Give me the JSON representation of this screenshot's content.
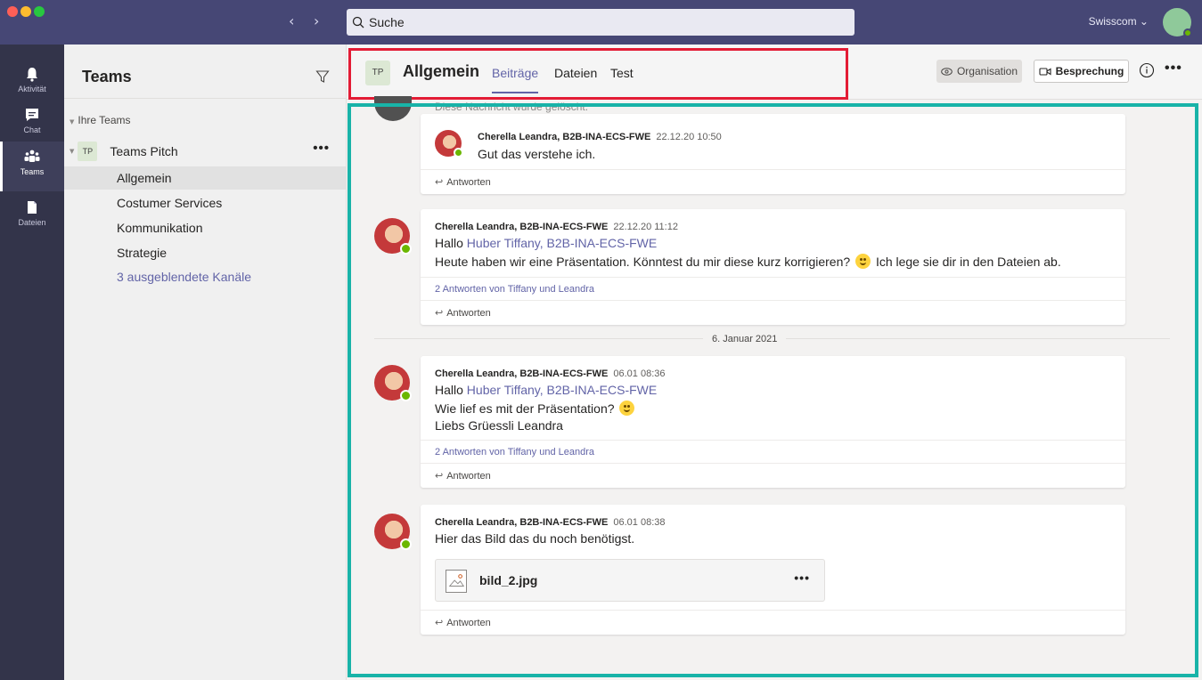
{
  "window": {
    "nav_back": "‹",
    "nav_forward": "›"
  },
  "search": {
    "placeholder": "Suche"
  },
  "account": {
    "org": "Swisscom ⌄"
  },
  "rail": {
    "items": [
      {
        "label": "Aktivität",
        "icon": "bell-icon"
      },
      {
        "label": "Chat",
        "icon": "chat-icon"
      },
      {
        "label": "Teams",
        "icon": "teams-icon"
      },
      {
        "label": "Dateien",
        "icon": "file-icon"
      }
    ]
  },
  "sidebar": {
    "title": "Teams",
    "section": "Ihre Teams",
    "team": {
      "badge": "TP",
      "name": "Teams Pitch",
      "more": "•••"
    },
    "channels": [
      "Allgemein",
      "Costumer Services",
      "Kommunikation",
      "Strategie"
    ],
    "hidden_channels": "3 ausgeblendete Kanäle"
  },
  "channel_header": {
    "badge": "TP",
    "title": "Allgemein",
    "tabs": [
      "Beiträge",
      "Dateien",
      "Test"
    ],
    "org_button": "Organisation",
    "meet_button": "Besprechung",
    "more": "•••"
  },
  "feed": {
    "truncated_text": "Diese Nachricht wurde gelöscht.",
    "reply_label": "Antworten",
    "messages": [
      {
        "author": "Cherella Leandra, B2B-INA-ECS-FWE",
        "time": "22.12.20 10:50",
        "text": "Gut das verstehe ich."
      },
      {
        "author": "Cherella Leandra, B2B-INA-ECS-FWE",
        "time": "22.12.20 11:12",
        "greeting": "Hallo",
        "mention": "Huber Tiffany, B2B-INA-ECS-FWE",
        "body_a": "Heute haben wir eine Präsentation. Könntest du mir diese kurz korrigieren?",
        "body_b": "Ich lege sie dir in den Dateien ab.",
        "replies": "2 Antworten von Tiffany und Leandra"
      },
      {
        "author": "Cherella Leandra, B2B-INA-ECS-FWE",
        "time": "06.01 08:36",
        "greeting": "Hallo",
        "mention": "Huber Tiffany, B2B-INA-ECS-FWE",
        "line2": "Wie lief es mit der Präsentation?",
        "line3": "Liebs Grüessli Leandra",
        "replies": "2 Antworten von Tiffany und Leandra"
      },
      {
        "author": "Cherella Leandra, B2B-INA-ECS-FWE",
        "time": "06.01 08:38",
        "text": "Hier das Bild das du noch benötigst.",
        "file": {
          "name": "bild_2.jpg",
          "more": "•••"
        }
      }
    ],
    "date_separator": "6. Januar 2021"
  }
}
